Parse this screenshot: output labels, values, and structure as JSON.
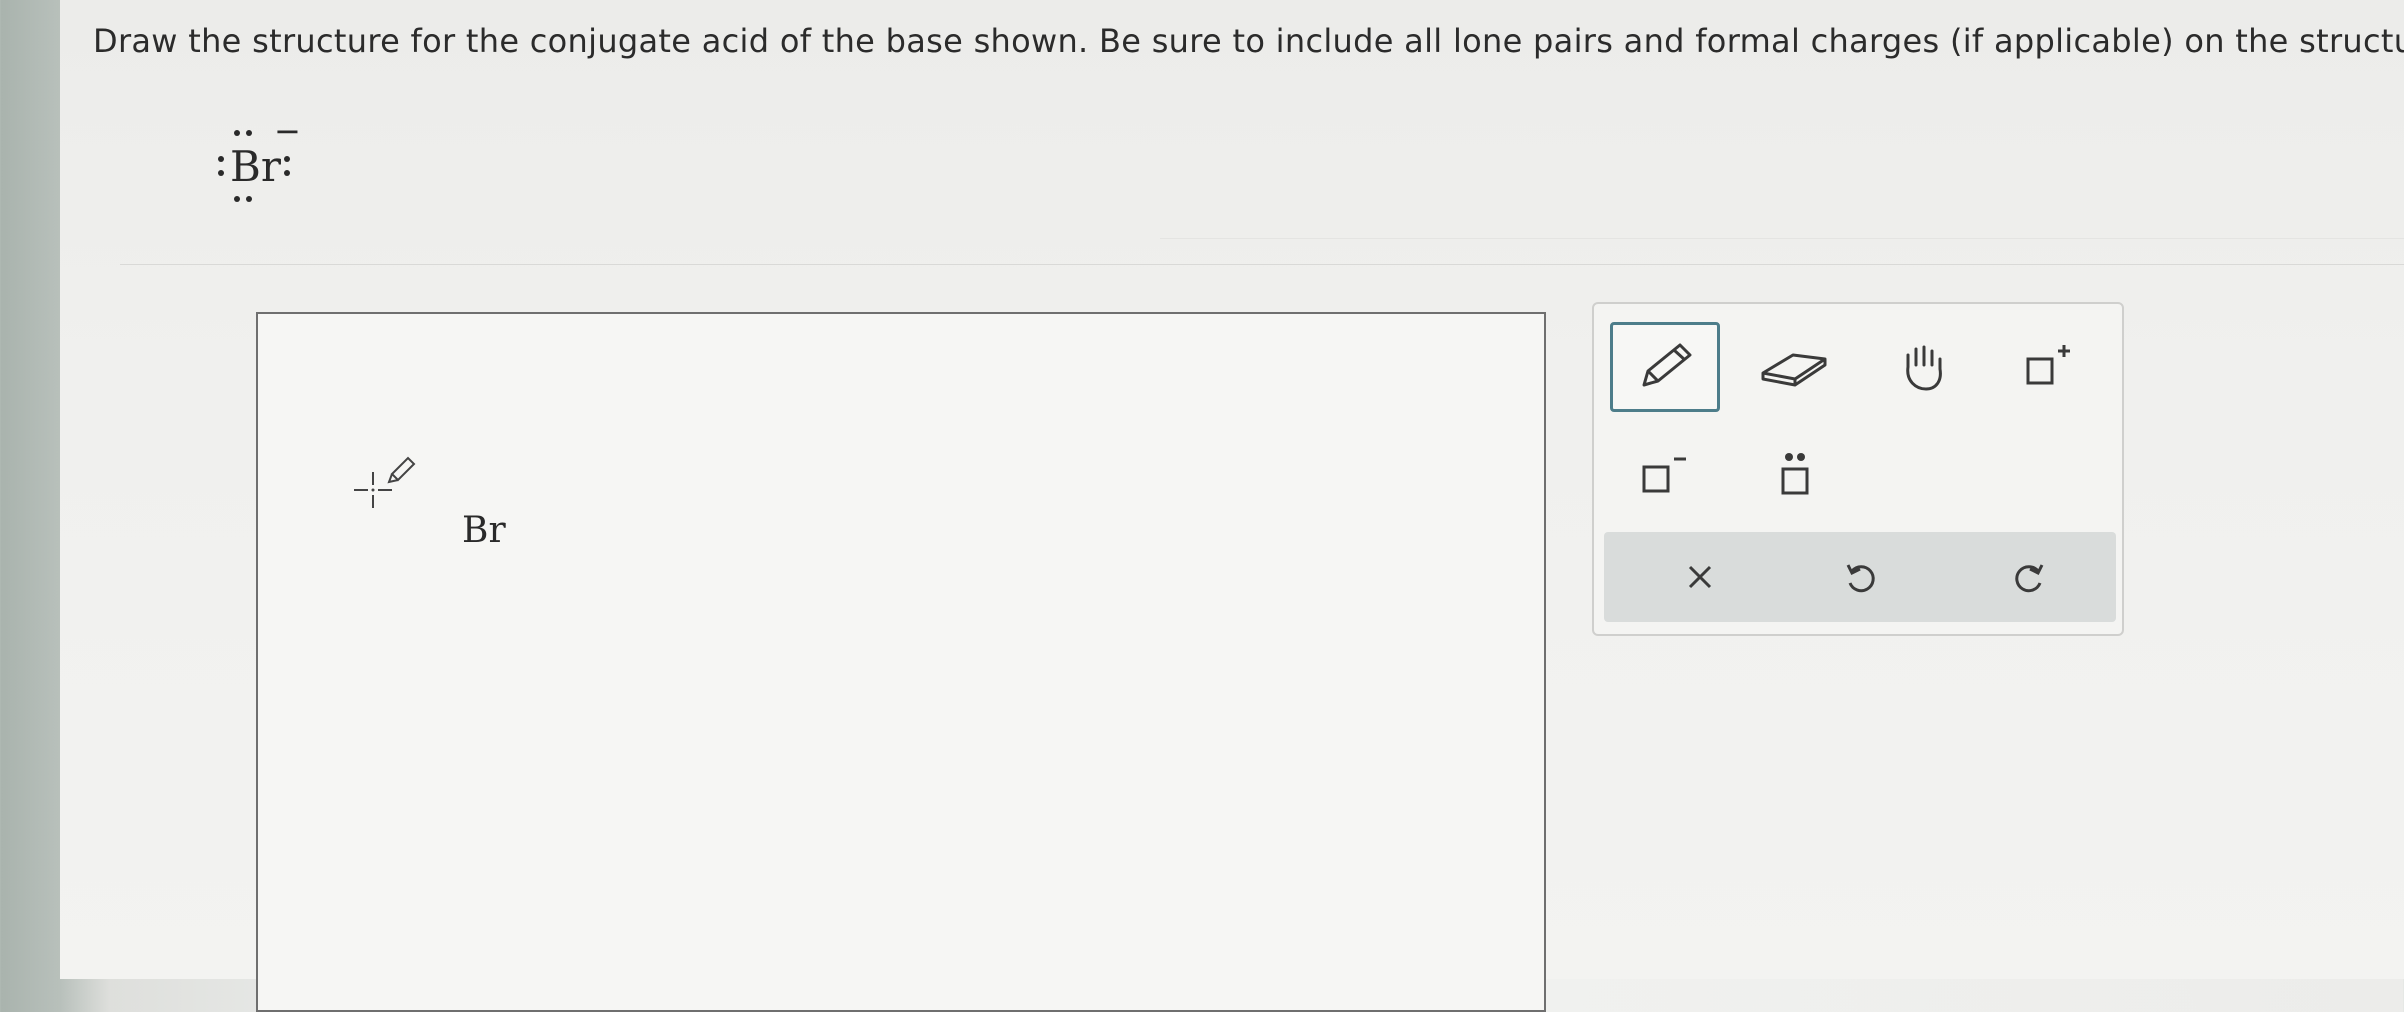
{
  "question": "Draw the structure for the conjugate acid of the base shown. Be sure to include all lone pairs and formal charges (if applicable) on the structure.",
  "molecule": {
    "symbol": "Br",
    "charge": "−",
    "lone_pairs": 4
  },
  "canvas": {
    "atom_label": "Br"
  },
  "toolbar": {
    "tools": [
      {
        "name": "pencil-tool",
        "icon": "pencil-icon",
        "selected": true
      },
      {
        "name": "eraser-tool",
        "icon": "eraser-icon",
        "selected": false
      },
      {
        "name": "hand-tool",
        "icon": "hand-icon",
        "selected": false
      },
      {
        "name": "positive-charge-tool",
        "icon": "positive-charge-icon",
        "selected": false
      },
      {
        "name": "negative-charge-tool",
        "icon": "negative-charge-icon",
        "selected": false
      },
      {
        "name": "lone-pair-tool",
        "icon": "lone-pair-icon",
        "selected": false
      }
    ],
    "actions": [
      {
        "name": "clear-button",
        "icon": "close-icon"
      },
      {
        "name": "undo-button",
        "icon": "undo-icon"
      },
      {
        "name": "redo-button",
        "icon": "redo-icon"
      }
    ]
  },
  "colors": {
    "accent": "#4d7d8a",
    "text": "#2b2b2b",
    "toolbar_bg": "#d9dcdb"
  }
}
